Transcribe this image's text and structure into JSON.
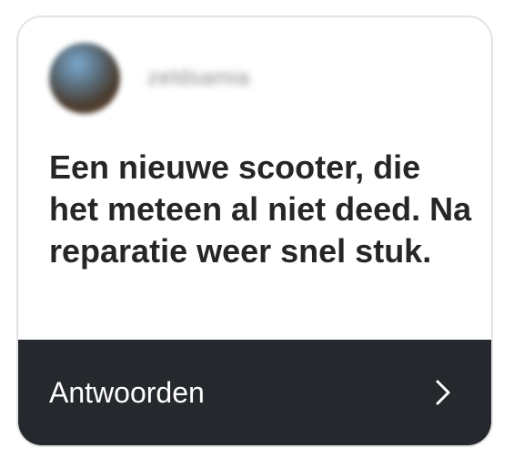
{
  "story_reply": {
    "username": "zeldsamia",
    "message": "Een nieuwe scooter, die het meteen al niet deed. Na reparatie weer snel stuk.",
    "reply_label": "Antwoorden",
    "icons": {
      "avatar": "user-avatar",
      "next": "chevron-right-icon"
    },
    "colors": {
      "footer_background": "#25282d",
      "text": "#262626",
      "footer_text": "#ffffff"
    }
  }
}
